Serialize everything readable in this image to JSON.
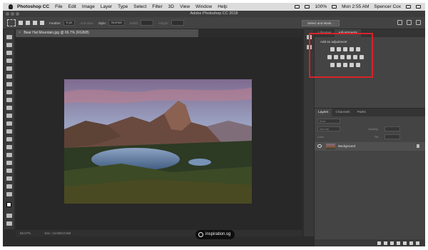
{
  "menubar": {
    "app_name": "Photoshop CC",
    "items": [
      "File",
      "Edit",
      "Image",
      "Layer",
      "Type",
      "Select",
      "Filter",
      "3D",
      "View",
      "Window",
      "Help"
    ],
    "battery": "100%",
    "clock": "Mon 2:55 AM",
    "user": "Spencer Cox"
  },
  "window": {
    "title": "Adobe Photoshop CC 2018"
  },
  "options": {
    "feather_label": "Feather:",
    "feather_value": "0 px",
    "antialias_label": "Anti-alias",
    "style_label": "Style:",
    "style_value": "Normal",
    "width_label": "Width:",
    "height_label": "Height:",
    "select_mask_label": "Select and Mask..."
  },
  "document": {
    "tab_label": "Bear Hat Mountain.jpg @ 66.7% (RGB/8)",
    "zoom": "66.67%",
    "doc_size": "Doc: 13.5M/13.5M"
  },
  "watermark": "inspiration.sg",
  "panels": {
    "top_tabs": [
      "Libraries",
      "Adjustments"
    ],
    "add_adjustment_label": "Add an adjustment",
    "layer_tabs": [
      "Layers",
      "Channels",
      "Paths"
    ],
    "kind_label": "Kind",
    "blend_mode": "Normal",
    "opacity_label": "Opacity:",
    "lock_label": "Lock:",
    "fill_label": "Fill:",
    "layer_name": "Background"
  },
  "colors": {
    "highlight": "#d8232a",
    "canvas": "#282828"
  }
}
